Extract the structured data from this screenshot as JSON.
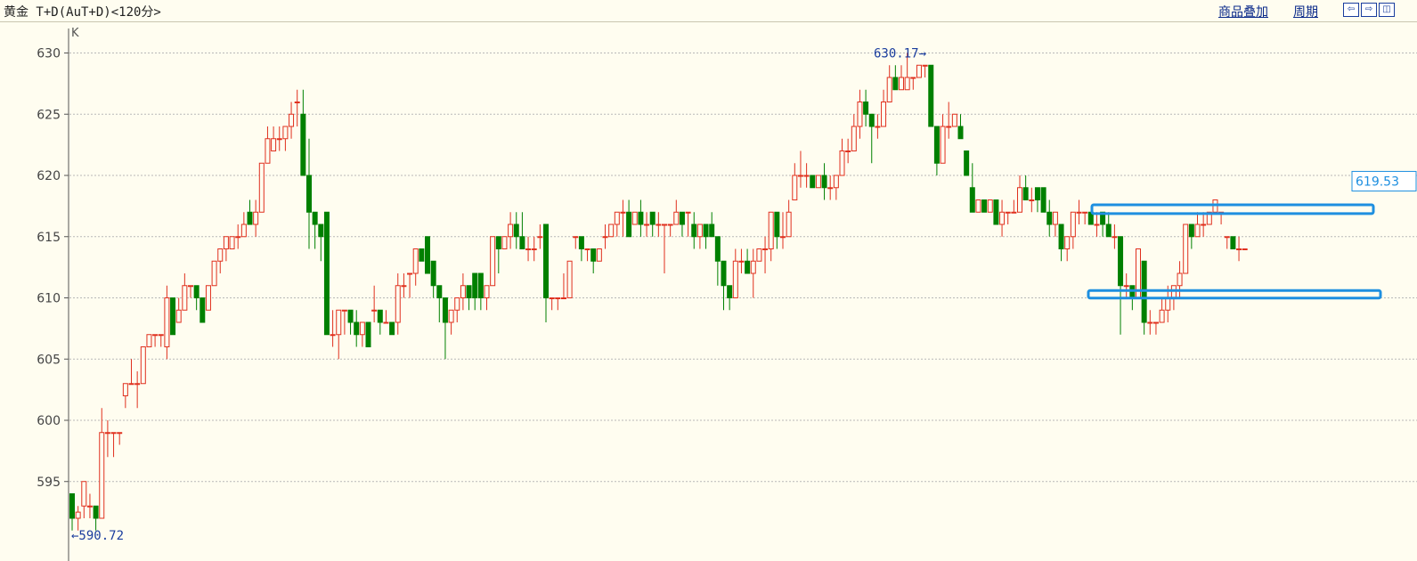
{
  "toolbar": {
    "title": "黄金 T+D(AuT+D)<120分>",
    "overlay_label": "商品叠加",
    "period_label": "周期",
    "nav_left_icon": "arrow-left-icon",
    "nav_right_icon": "arrow-right-icon",
    "panel_icon": "panel-icon"
  },
  "chart_data": {
    "type": "candlestick",
    "panel_label": "K",
    "ylim": [
      591,
      631
    ],
    "yticks": [
      595,
      600,
      605,
      610,
      615,
      620,
      625,
      630
    ],
    "grid": true,
    "high_annotation": "630.17",
    "low_annotation": "590.72",
    "last_price_label": "619.53",
    "colors": {
      "up": "#e0301e",
      "down": "#008000",
      "grid": "#b8b8b8",
      "axis": "#555555",
      "box": "#1e8fe0",
      "label": "#1a3d9e"
    },
    "candles": [
      [
        594,
        592,
        594,
        591
      ],
      [
        592,
        592.5,
        593,
        591
      ],
      [
        593,
        595,
        595,
        592
      ],
      [
        593,
        593,
        594,
        592
      ],
      [
        593,
        592,
        593,
        591
      ],
      [
        592,
        599,
        601,
        592
      ],
      [
        599,
        599,
        600,
        597
      ],
      [
        599,
        599,
        599,
        597
      ],
      [
        599,
        599,
        599,
        598
      ],
      [
        602,
        603,
        603,
        601
      ],
      [
        603,
        603,
        605,
        603
      ],
      [
        603,
        603,
        604,
        601
      ],
      [
        603,
        606,
        606,
        603
      ],
      [
        606,
        607,
        607,
        606
      ],
      [
        607,
        607,
        607,
        606
      ],
      [
        607,
        607,
        607,
        606
      ],
      [
        606,
        610,
        611,
        605
      ],
      [
        610,
        607,
        610,
        607
      ],
      [
        608,
        609,
        610,
        608
      ],
      [
        609,
        611,
        612,
        609
      ],
      [
        611,
        611,
        611,
        610
      ],
      [
        611,
        610,
        611,
        609
      ],
      [
        610,
        608,
        610,
        608
      ],
      [
        609,
        611,
        611,
        609
      ],
      [
        611,
        613,
        613,
        611
      ],
      [
        613,
        614,
        614,
        612
      ],
      [
        614,
        615,
        615,
        613
      ],
      [
        614,
        615,
        615,
        614
      ],
      [
        615,
        615,
        616,
        614
      ],
      [
        615,
        616,
        617,
        615
      ],
      [
        617,
        616,
        618,
        616
      ],
      [
        616,
        617,
        618,
        615
      ],
      [
        617,
        621,
        621,
        617
      ],
      [
        621,
        623,
        624,
        621
      ],
      [
        622,
        623,
        624,
        622
      ],
      [
        623,
        623,
        624,
        622
      ],
      [
        623,
        624,
        624,
        622
      ],
      [
        624,
        625,
        626,
        623
      ],
      [
        626,
        626,
        627,
        624
      ],
      [
        625,
        620,
        627,
        620
      ],
      [
        620,
        617,
        623,
        614
      ],
      [
        617,
        616,
        617,
        614
      ],
      [
        616,
        615,
        616,
        613
      ],
      [
        617,
        607,
        617,
        607
      ],
      [
        607,
        607,
        609,
        606
      ],
      [
        607,
        609,
        609,
        605
      ],
      [
        609,
        609,
        609,
        607
      ],
      [
        609,
        608,
        609,
        607
      ],
      [
        608,
        607,
        609,
        606
      ],
      [
        607,
        608,
        608,
        606
      ],
      [
        608,
        606,
        608,
        606
      ],
      [
        609,
        609,
        611,
        608
      ],
      [
        609,
        608,
        609,
        607
      ],
      [
        608,
        608,
        609,
        608
      ],
      [
        608,
        607,
        608,
        607
      ],
      [
        608,
        611,
        612,
        607
      ],
      [
        611,
        611,
        612,
        610
      ],
      [
        612,
        612,
        612,
        610
      ],
      [
        612,
        614,
        614,
        611
      ],
      [
        614,
        613,
        614,
        613
      ],
      [
        615,
        612,
        615,
        612
      ],
      [
        613,
        611,
        613,
        610
      ],
      [
        611,
        610,
        611,
        608
      ],
      [
        610,
        608,
        610,
        605
      ],
      [
        608,
        609,
        609,
        607
      ],
      [
        609,
        610,
        610,
        608
      ],
      [
        610,
        611,
        612,
        609
      ],
      [
        611,
        610,
        611,
        609
      ],
      [
        612,
        610,
        612,
        609
      ],
      [
        612,
        610,
        612,
        609
      ],
      [
        610,
        611,
        611,
        609
      ],
      [
        611,
        615,
        615,
        611
      ],
      [
        615,
        614,
        615,
        612
      ],
      [
        614,
        615,
        615,
        614
      ],
      [
        615,
        616,
        617,
        614
      ],
      [
        616,
        615,
        617,
        614
      ],
      [
        615,
        614,
        617,
        614
      ],
      [
        614,
        614,
        615,
        613
      ],
      [
        614,
        614,
        615,
        613
      ],
      [
        615,
        615,
        616,
        614
      ],
      [
        616,
        610,
        616,
        608
      ],
      [
        610,
        610,
        610,
        609
      ],
      [
        610,
        610,
        610,
        609
      ],
      [
        610,
        610,
        612,
        610
      ],
      [
        610,
        613,
        613,
        610
      ],
      [
        615,
        615,
        615,
        614
      ],
      [
        615,
        614,
        615,
        613
      ],
      [
        614,
        614,
        614,
        613
      ],
      [
        614,
        613,
        614,
        612
      ],
      [
        613,
        614,
        614,
        613
      ],
      [
        615,
        615,
        616,
        614
      ],
      [
        615,
        616,
        616,
        615
      ],
      [
        616,
        617,
        617,
        615
      ],
      [
        617,
        617,
        618,
        615
      ],
      [
        617,
        615,
        618,
        615
      ],
      [
        616,
        617,
        617,
        616
      ],
      [
        617,
        616,
        618,
        615
      ],
      [
        616,
        616,
        617,
        615
      ],
      [
        617,
        616,
        617,
        615
      ],
      [
        616,
        616,
        617,
        615
      ],
      [
        616,
        616,
        616,
        612
      ],
      [
        616,
        616,
        616,
        615
      ],
      [
        616,
        617,
        618,
        616
      ],
      [
        617,
        616,
        617,
        615
      ],
      [
        617,
        617,
        617,
        615
      ],
      [
        616,
        615,
        617,
        614
      ],
      [
        615,
        616,
        616,
        614
      ],
      [
        616,
        615,
        616,
        614
      ],
      [
        616,
        615,
        617,
        615
      ],
      [
        615,
        613,
        615,
        611
      ],
      [
        613,
        611,
        613,
        609
      ],
      [
        611,
        610,
        611,
        609
      ],
      [
        610,
        613,
        614,
        610
      ],
      [
        613,
        613,
        614,
        612
      ],
      [
        613,
        612,
        614,
        612
      ],
      [
        612,
        613,
        614,
        610
      ],
      [
        613,
        614,
        614,
        613
      ],
      [
        614,
        614,
        615,
        612
      ],
      [
        614,
        617,
        617,
        613
      ],
      [
        617,
        615,
        617,
        614
      ],
      [
        615,
        615,
        617,
        614
      ],
      [
        615,
        617,
        618,
        615
      ],
      [
        618,
        620,
        621,
        618
      ],
      [
        620,
        620,
        622,
        619
      ],
      [
        620,
        620,
        621,
        619
      ],
      [
        620,
        619,
        620,
        619
      ],
      [
        619,
        620,
        620,
        619
      ],
      [
        620,
        619,
        621,
        618
      ],
      [
        619,
        619,
        620,
        618
      ],
      [
        619,
        620,
        620,
        618
      ],
      [
        620,
        622,
        623,
        620
      ],
      [
        622,
        622,
        623,
        621
      ],
      [
        622,
        624,
        625,
        622
      ],
      [
        624,
        626,
        627,
        623
      ],
      [
        626,
        625,
        627,
        624
      ],
      [
        625,
        624,
        625,
        621
      ],
      [
        624,
        624,
        625,
        623
      ],
      [
        624,
        626,
        627,
        624
      ],
      [
        626,
        628,
        629,
        626
      ],
      [
        628,
        627,
        629,
        627
      ],
      [
        627,
        628,
        629,
        627
      ],
      [
        627,
        628,
        630,
        627
      ],
      [
        628,
        628,
        628,
        627
      ],
      [
        628,
        629,
        629,
        628
      ],
      [
        629,
        629,
        629,
        628
      ],
      [
        629,
        624,
        629,
        624
      ],
      [
        624,
        621,
        624,
        620
      ],
      [
        621,
        624,
        625,
        621
      ],
      [
        624,
        624,
        626,
        623
      ],
      [
        624,
        625,
        625,
        624
      ],
      [
        624,
        623,
        625,
        623
      ],
      [
        622,
        620,
        622,
        620
      ],
      [
        619,
        617,
        621,
        617
      ],
      [
        617,
        618,
        618,
        617
      ],
      [
        618,
        617,
        618,
        617
      ],
      [
        617,
        618,
        618,
        617
      ],
      [
        618,
        616,
        618,
        616
      ],
      [
        616,
        617,
        618,
        615
      ],
      [
        617,
        617,
        617,
        616
      ],
      [
        617,
        617,
        618,
        617
      ],
      [
        617,
        619,
        620,
        617
      ],
      [
        619,
        618,
        620,
        618
      ],
      [
        618,
        618,
        619,
        617
      ],
      [
        619,
        618,
        619,
        617
      ],
      [
        619,
        617,
        619,
        617
      ],
      [
        617,
        616,
        618,
        615
      ],
      [
        616,
        617,
        617,
        615
      ],
      [
        616,
        614,
        616,
        613
      ],
      [
        614,
        615,
        615,
        613
      ],
      [
        615,
        617,
        617,
        614
      ],
      [
        617,
        617,
        618,
        616
      ],
      [
        617,
        617,
        617,
        616
      ],
      [
        617,
        616,
        617,
        616
      ],
      [
        616,
        616,
        617,
        615
      ],
      [
        617,
        616,
        617,
        615
      ],
      [
        616,
        615,
        617,
        615
      ],
      [
        615,
        615,
        616,
        614
      ],
      [
        615,
        611,
        615,
        607
      ],
      [
        611,
        611,
        612,
        610
      ],
      [
        611,
        610,
        611,
        609
      ],
      [
        610,
        614,
        614,
        610
      ],
      [
        613,
        608,
        613,
        607
      ],
      [
        608,
        608,
        609,
        607
      ],
      [
        608,
        608,
        608,
        607
      ],
      [
        608,
        609,
        610,
        608
      ],
      [
        609,
        610,
        611,
        608
      ],
      [
        610,
        611,
        611,
        609
      ],
      [
        611,
        612,
        613,
        610
      ],
      [
        612,
        616,
        616,
        612
      ],
      [
        616,
        615,
        616,
        614
      ],
      [
        615,
        616,
        617,
        615
      ],
      [
        616,
        616,
        617,
        615
      ],
      [
        616,
        617,
        617,
        616
      ],
      [
        617,
        618,
        618,
        617
      ],
      [
        617,
        617,
        617,
        616
      ],
      [
        615,
        615,
        615,
        614
      ],
      [
        615,
        614,
        615,
        614
      ],
      [
        614,
        614,
        615,
        613
      ],
      [
        614,
        614,
        614,
        614
      ]
    ],
    "resistance_box": [
      617.1,
      617.6
    ],
    "support_box": [
      610.2,
      610.6
    ]
  }
}
